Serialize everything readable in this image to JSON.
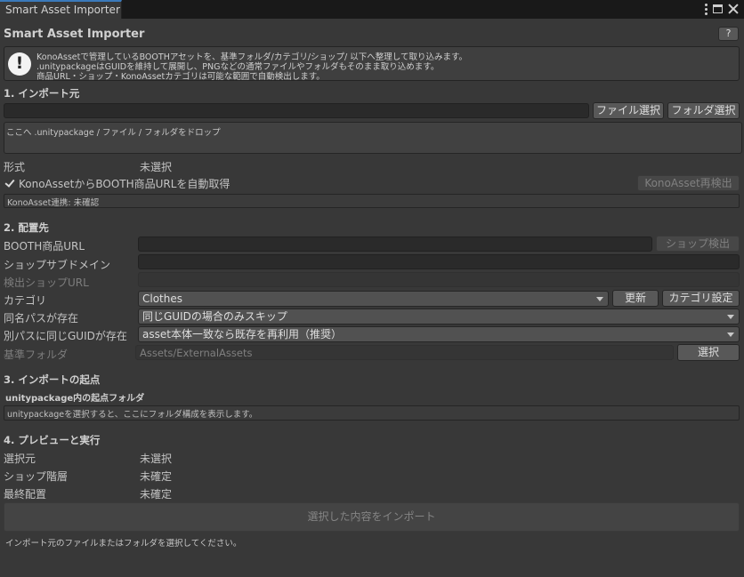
{
  "tab": {
    "title": "Smart Asset Importer"
  },
  "header": {
    "title": "Smart Asset Importer",
    "help": "?"
  },
  "info": {
    "lines": [
      "KonoAssetで管理しているBOOTHアセットを、基準フォルダ/カテゴリ/ショップ/ 以下へ整理して取り込みます。",
      ".unitypackageはGUIDを維持して展開し、PNGなどの通常ファイルやフォルダもそのまま取り込めます。",
      "商品URL・ショップ・KonoAssetカテゴリは可能な範囲で自動検出します。"
    ]
  },
  "section1": {
    "heading": "1. インポート元",
    "path_value": "",
    "file_button": "ファイル選択",
    "folder_button": "フォルダ選択",
    "dropzone_text": "ここへ .unitypackage / ファイル / フォルダをドロップ",
    "format_label": "形式",
    "format_value": "未選択",
    "auto_fetch_label": "KonoAssetからBOOTH商品URLを自動取得",
    "auto_fetch_checked": true,
    "redetect_button": "KonoAsset再検出",
    "status_text": "KonoAsset連携: 未確認"
  },
  "section2": {
    "heading": "2. 配置先",
    "booth_url_label": "BOOTH商品URL",
    "booth_url_value": "",
    "shop_detect_button": "ショップ検出",
    "shop_subdomain_label": "ショップサブドメイン",
    "shop_subdomain_value": "",
    "detected_shop_url_label": "検出ショップURL",
    "detected_shop_url_value": "",
    "category_label": "カテゴリ",
    "category_value": "Clothes",
    "refresh_button": "更新",
    "category_settings_button": "カテゴリ設定",
    "same_path_label": "同名パスが存在",
    "same_path_value": "同じGUIDの場合のみスキップ",
    "same_guid_label": "別パスに同じGUIDが存在",
    "same_guid_value": "asset本体一致なら既存を再利用（推奨）",
    "base_folder_label": "基準フォルダ",
    "base_folder_value": "Assets/ExternalAssets",
    "select_button": "選択"
  },
  "section3": {
    "heading": "3. インポートの起点",
    "subheading": "unitypackage内の起点フォルダ",
    "status_text": "unitypackageを選択すると、ここにフォルダ構成を表示します。"
  },
  "section4": {
    "heading": "4. プレビューと実行",
    "rows": [
      {
        "label": "選択元",
        "value": "未選択"
      },
      {
        "label": "ショップ階層",
        "value": "未確定"
      },
      {
        "label": "最終配置",
        "value": "未確定"
      }
    ],
    "import_button": "選択した内容をインポート",
    "footer_text": "インポート元のファイルまたはフォルダを選択してください。"
  },
  "colors": {
    "background": "#383838",
    "accent": "#3a79bb"
  }
}
